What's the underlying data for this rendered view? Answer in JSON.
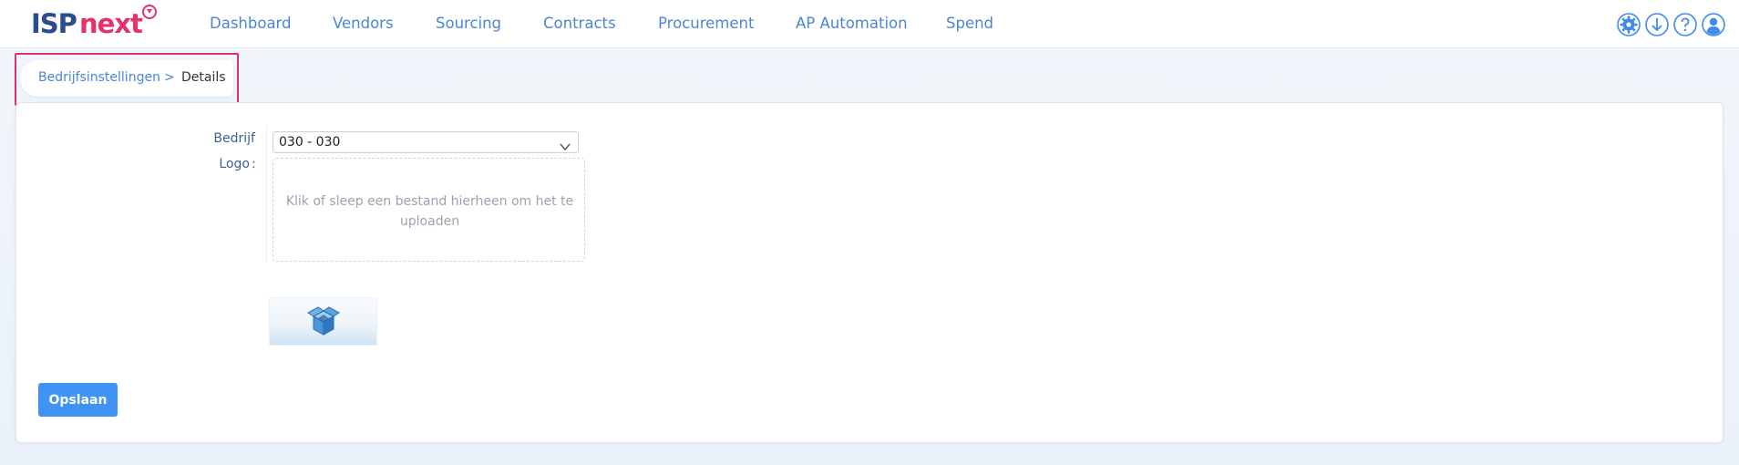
{
  "brand": {
    "part1": "ISP",
    "part2": "next",
    "accent": "#e5336a",
    "primary": "#2b4c8f"
  },
  "nav": {
    "items": [
      {
        "label": "Dashboard"
      },
      {
        "label": "Vendors"
      },
      {
        "label": "Sourcing"
      },
      {
        "label": "Contracts"
      },
      {
        "label": "Procurement"
      },
      {
        "label": "AP Automation"
      },
      {
        "label": "Spend"
      }
    ]
  },
  "topIcons": [
    "gear-icon",
    "download-icon",
    "help-icon",
    "user-icon"
  ],
  "breadcrumb": {
    "parent": "Bedrijfsinstellingen",
    "separator": ">",
    "current": "Details"
  },
  "form": {
    "company_label": "Bedrijf",
    "company_value": "030 - 030",
    "logo_label": "Logo",
    "logo_colon": ":",
    "dropzone_text": "Klik of sleep een bestand hierheen om het te uploaden",
    "save_label": "Opslaan"
  },
  "colors": {
    "link": "#4a86d4",
    "button": "#3f93f4",
    "highlight": "#e0306f"
  }
}
